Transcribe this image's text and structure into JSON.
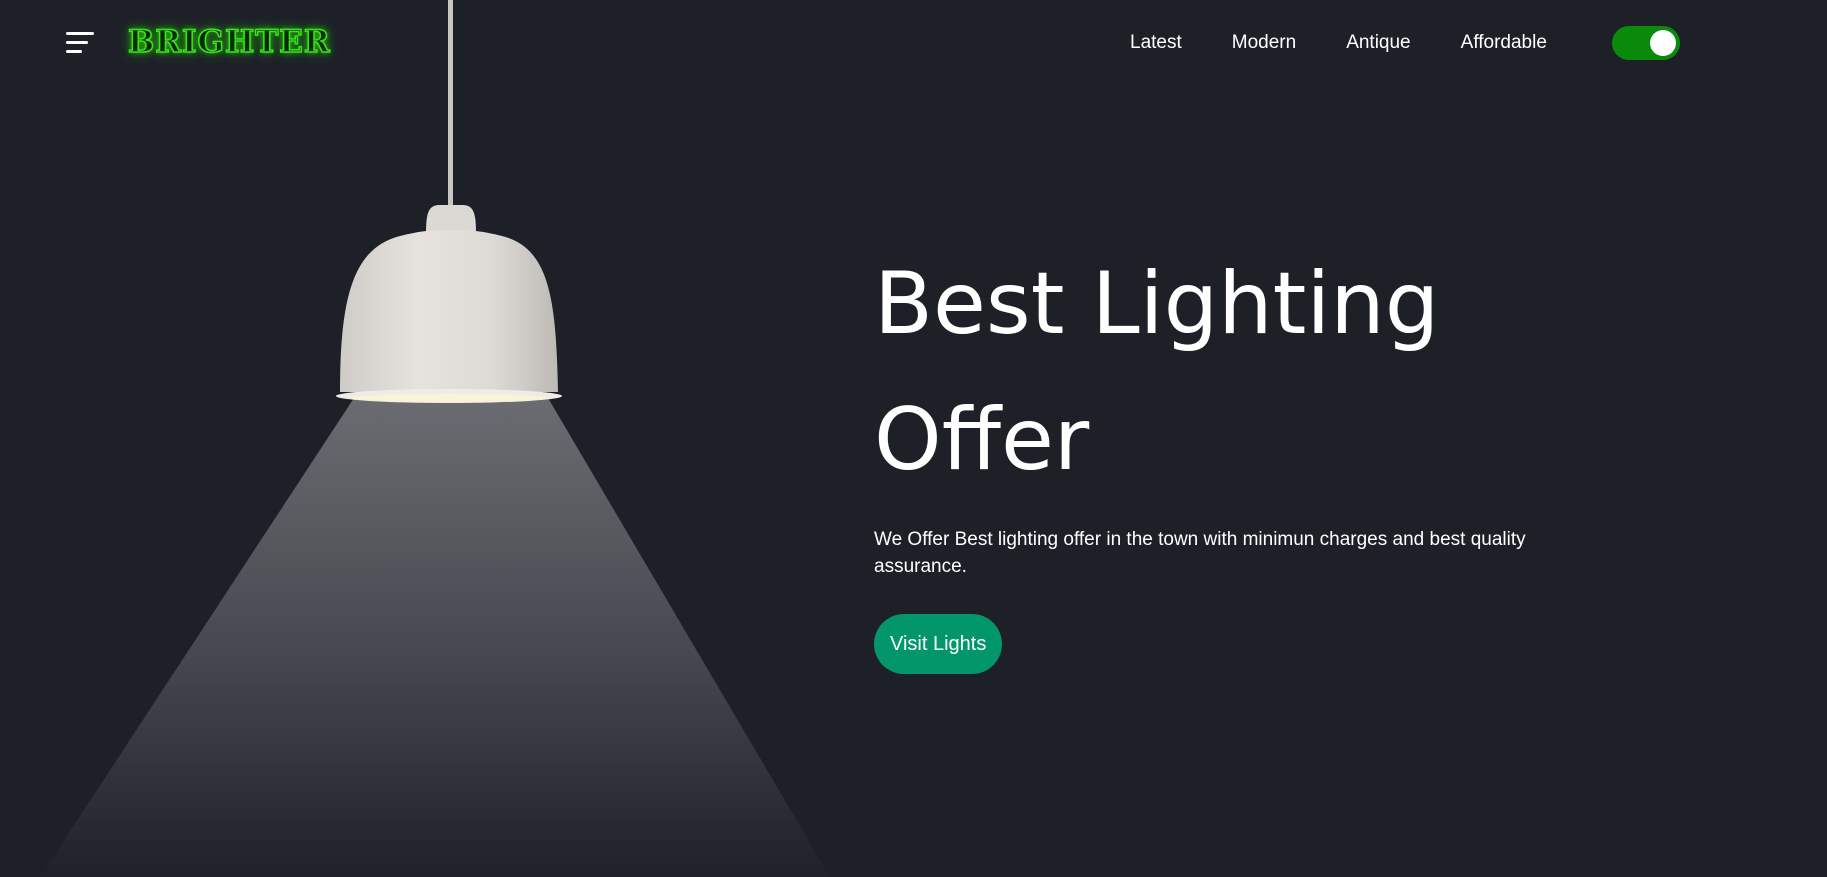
{
  "header": {
    "logo_text": "BRIGHTER",
    "nav": [
      {
        "label": "Latest"
      },
      {
        "label": "Modern"
      },
      {
        "label": "Antique"
      },
      {
        "label": "Affordable"
      }
    ],
    "theme_toggle": {
      "state": "on",
      "color": "#0a8a0a"
    }
  },
  "hero": {
    "title_line1": "Best Lighting",
    "title_line2": "Offer",
    "description": "We Offer Best lighting offer in the town with minimun charges and best quality assurance.",
    "cta_label": "Visit Lights"
  },
  "colors": {
    "background": "#1e2028",
    "accent": "#03966b",
    "logo_glow": "#39e61c"
  },
  "icons": {
    "menu": "hamburger-menu-icon",
    "lamp": "pendant-lamp-illustration"
  }
}
